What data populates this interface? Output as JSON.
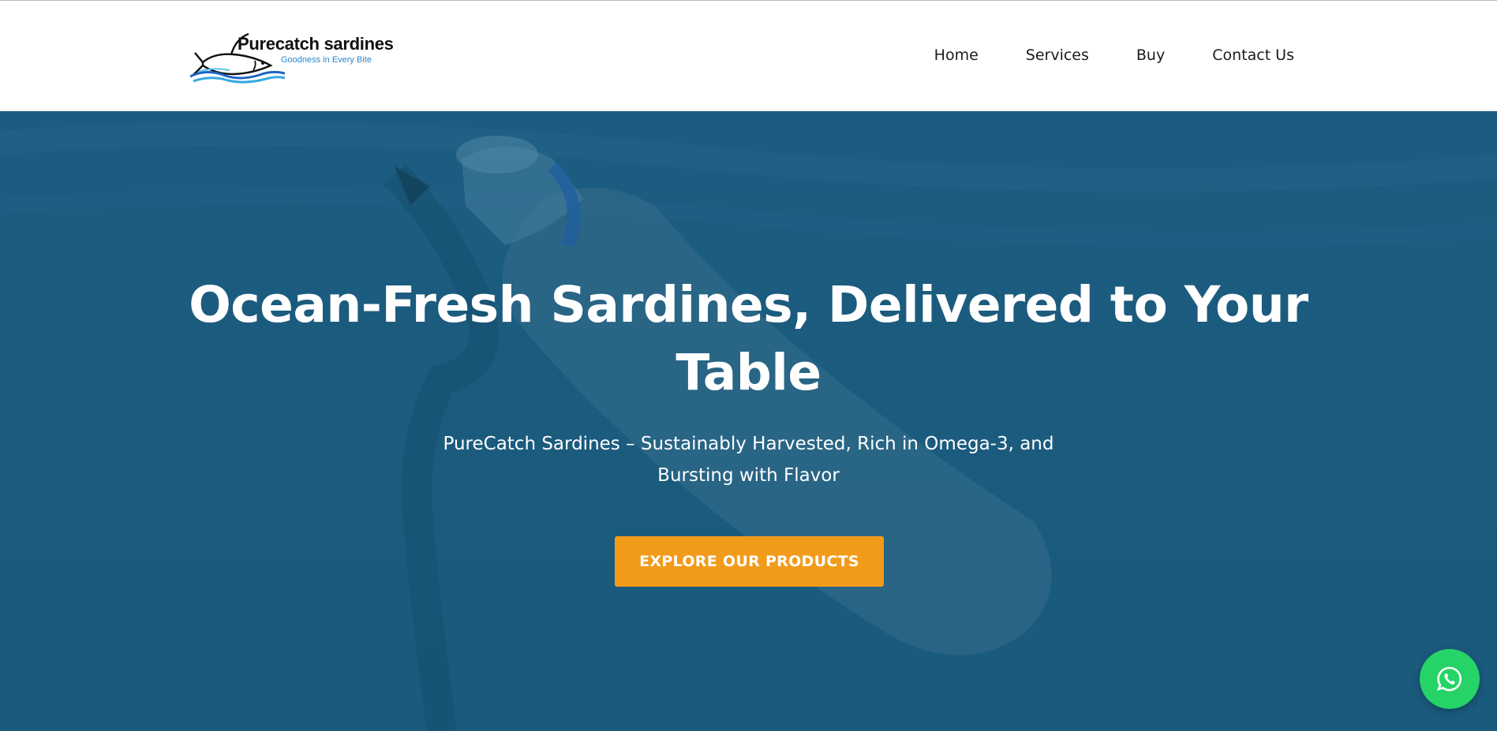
{
  "brand": {
    "name": "Purecatch sardines",
    "tagline": "Goodness in Every Bite"
  },
  "nav": {
    "items": [
      "Home",
      "Services",
      "Buy",
      "Contact Us"
    ]
  },
  "hero": {
    "headline_line1": "Ocean-Fresh Sardines, Delivered to Your",
    "headline_line2": "Table",
    "subheadline_line1": "PureCatch Sardines – Sustainably Harvested, Rich in Omega-3, and",
    "subheadline_line2": "Bursting with Flavor",
    "cta_label": "EXPLORE OUR PRODUCTS"
  },
  "floating": {
    "whatsapp_icon": "whatsapp-icon"
  },
  "colors": {
    "hero_overlay": "#1b5b7e",
    "cta": "#f29b1b",
    "whatsapp": "#25d366",
    "tagline": "#2a86c8"
  }
}
